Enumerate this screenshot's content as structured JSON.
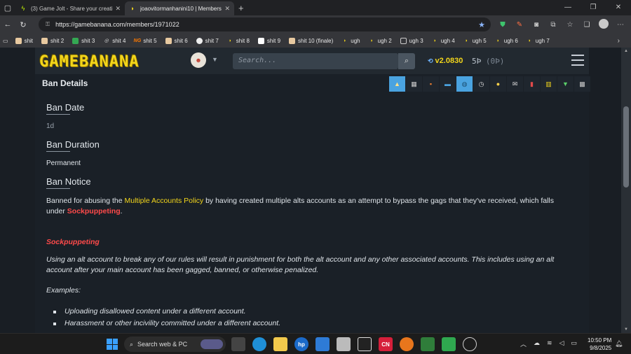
{
  "browser": {
    "tabs": [
      {
        "title": "(3) Game Jolt - Share your creatio",
        "favicon": "gamejolt-icon",
        "active": false
      },
      {
        "title": "joaovitormanhanini10 | Members",
        "favicon": "banana-icon",
        "active": true
      }
    ],
    "url": "https://gamebanana.com/members/1971022",
    "bookmarks": [
      {
        "label": "shit"
      },
      {
        "label": "shit 2"
      },
      {
        "label": "shit 3"
      },
      {
        "label": "shit 4"
      },
      {
        "label": "shit 5"
      },
      {
        "label": "shit 6"
      },
      {
        "label": "shit 7"
      },
      {
        "label": "shit 8"
      },
      {
        "label": "shit 9"
      },
      {
        "label": "shit 10 (finale)"
      },
      {
        "label": "ugh"
      },
      {
        "label": "ugh 2"
      },
      {
        "label": "ugh 3"
      },
      {
        "label": "ugh 4"
      },
      {
        "label": "ugh 5"
      },
      {
        "label": "ugh 6"
      },
      {
        "label": "ugh 7"
      }
    ]
  },
  "site": {
    "logo_text": "GAMEBANANA",
    "search_placeholder": "Search...",
    "version": "v2.0830",
    "bananas": "5Ϸ",
    "bananas_paren": "(0Ϸ)"
  },
  "ban": {
    "section_title": "Ban Details",
    "date_label": "Ban Date",
    "date_value": "1d",
    "duration_label": "Ban Duration",
    "duration_value": "Permanent",
    "notice_label": "Ban Notice",
    "notice_pre": "Banned for abusing the ",
    "notice_link": "Multiple Accounts Policy",
    "notice_mid": " by having created multiple alts accounts as an attempt to bypass the gags that they've received, which falls under ",
    "notice_red": "Sockpuppeting",
    "notice_end": ".",
    "rule_heading": "Sockpuppeting",
    "rule_text": "Using an alt account to break any of our rules will result in punishment for both the alt account and any other associated accounts. This includes using an alt account after your main account has been gagged, banned, or otherwise penalized.",
    "examples_label": "Examples:",
    "examples": [
      "Uploading disallowed content under a different account.",
      "Harassment or other incivility committed under a different account."
    ]
  },
  "taskbar": {
    "search_text": "Search web & PC",
    "time": "10:50 PM",
    "date": "9/8/2025"
  }
}
